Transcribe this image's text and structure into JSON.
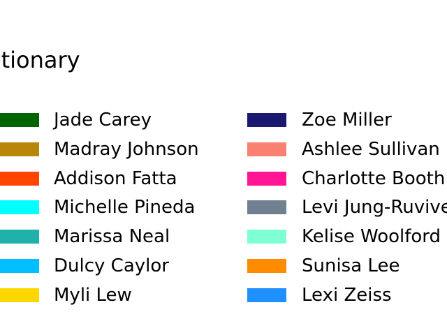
{
  "chart_data": {
    "type": "legend",
    "title": "ctionary",
    "legend": {
      "columns": [
        [
          {
            "label": "Jade Carey",
            "color": "#006400"
          },
          {
            "label": "Madray Johnson",
            "color": "#b8860b"
          },
          {
            "label": "Addison Fatta",
            "color": "#ff4500"
          },
          {
            "label": "Michelle Pineda",
            "color": "#00ffff"
          },
          {
            "label": "Marissa Neal",
            "color": "#20b2aa"
          },
          {
            "label": "Dulcy Caylor",
            "color": "#00bfff"
          },
          {
            "label": "Myli Lew",
            "color": "#ffd700"
          }
        ],
        [
          {
            "label": "Zoe Miller",
            "color": "#191970"
          },
          {
            "label": "Ashlee Sullivan",
            "color": "#fa8072"
          },
          {
            "label": "Charlotte Booth",
            "color": "#ff1493"
          },
          {
            "label": "Levi Jung-Ruvive",
            "color": "#708090"
          },
          {
            "label": "Kelise Woolford",
            "color": "#7fffd4"
          },
          {
            "label": "Sunisa Lee",
            "color": "#ff8c00"
          },
          {
            "label": "Lexi Zeiss",
            "color": "#1e90ff"
          }
        ]
      ]
    }
  }
}
